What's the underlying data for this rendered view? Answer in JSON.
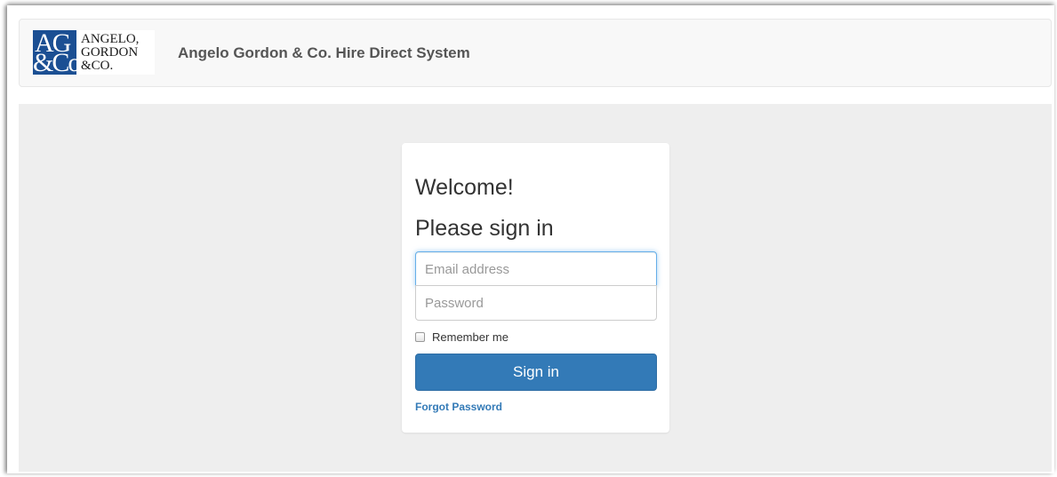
{
  "header": {
    "logo_mark": [
      "AG",
      "&Co"
    ],
    "logo_text": [
      "ANGELO,",
      "GORDON",
      "&CO."
    ],
    "brand_title": "Angelo Gordon & Co. Hire Direct System"
  },
  "login": {
    "welcome": "Welcome!",
    "please_sign_in": "Please sign in",
    "email_placeholder": "Email address",
    "email_value": "",
    "password_placeholder": "Password",
    "remember_label": "Remember me",
    "remember_checked": false,
    "signin_label": "Sign in",
    "forgot_label": "Forgot Password"
  },
  "colors": {
    "brand_blue": "#1b4f93",
    "primary_button": "#337ab7",
    "link": "#337ab7",
    "content_bg": "#eeeeee",
    "navbar_bg": "#f8f8f8"
  }
}
